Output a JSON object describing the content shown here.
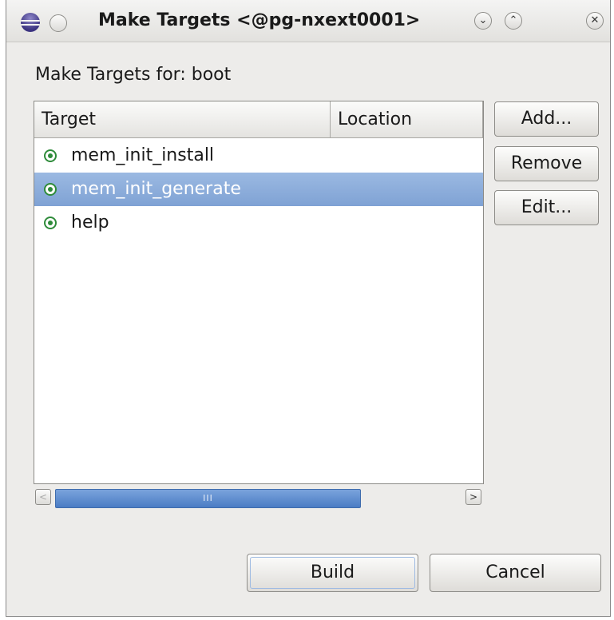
{
  "window": {
    "title": "Make Targets  <@pg-nxext0001>",
    "menu_icon": "circle-menu-icon",
    "app_icon": "eclipse-icon",
    "minimize_glyph": "⌄",
    "maximize_glyph": "⌃",
    "close_glyph": "✕"
  },
  "dialog": {
    "heading": "Make Targets for: boot",
    "table": {
      "columns": [
        "Target",
        "Location"
      ],
      "rows": [
        {
          "target": "mem_init_install",
          "location": "",
          "selected": false
        },
        {
          "target": "mem_init_generate",
          "location": "",
          "selected": true
        },
        {
          "target": "help",
          "location": "",
          "selected": false
        }
      ]
    },
    "scrollbar": {
      "left_arrow": "<",
      "right_arrow": ">",
      "grip": "III"
    },
    "side_buttons": {
      "add": "Add...",
      "remove": "Remove",
      "edit": "Edit..."
    },
    "footer_buttons": {
      "build": "Build",
      "cancel": "Cancel"
    }
  },
  "colors": {
    "selection": "#8aaddb",
    "target_icon": "#2e8b3a",
    "scroll_thumb": "#5a88cc"
  }
}
